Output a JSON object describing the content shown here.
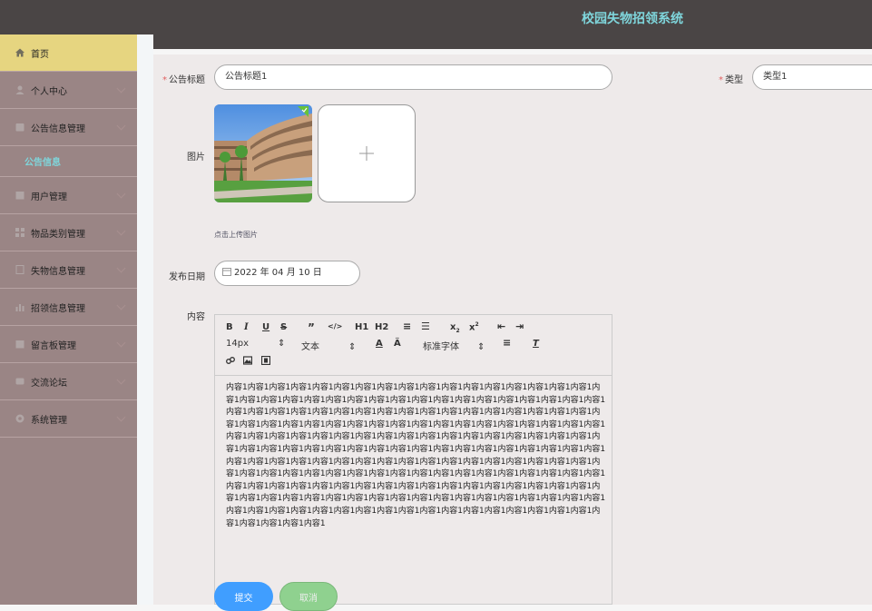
{
  "header": {
    "title": "校园失物招领系统"
  },
  "sidebar": {
    "items": [
      {
        "label": "首页",
        "icon": "home-icon",
        "active": true
      },
      {
        "label": "个人中心",
        "icon": "user-icon"
      },
      {
        "label": "公告信息管理",
        "icon": "notice-icon"
      },
      {
        "label": "用户管理",
        "icon": "users-icon"
      },
      {
        "label": "物品类别管理",
        "icon": "category-icon"
      },
      {
        "label": "失物信息管理",
        "icon": "lost-item-icon"
      },
      {
        "label": "招领信息管理",
        "icon": "chart-icon"
      },
      {
        "label": "留言板管理",
        "icon": "message-icon"
      },
      {
        "label": "交流论坛",
        "icon": "forum-icon"
      },
      {
        "label": "系统管理",
        "icon": "settings-icon"
      }
    ],
    "subitem": "公告信息"
  },
  "form": {
    "title_label": "公告标题",
    "title_value": "公告标题1",
    "type_label": "类型",
    "type_value": "类型1",
    "image_label": "图片",
    "upload_hint": "点击上传图片",
    "date_label": "发布日期",
    "date_value": "2022 年 04 月 10 日",
    "content_label": "内容",
    "content_value": "内容1内容1内容1内容1内容1内容1内容1内容1内容1内容1内容1内容1内容1内容1内容1内容1内容1内容1内容1内容1内容1内容1内容1内容1内容1内容1内容1内容1内容1内容1内容1内容1内容1内容1内容1内容1内容1内容1内容1内容1内容1内容1内容1内容1内容1内容1内容1内容1内容1内容1内容1内容1内容1内容1内容1内容1内容1内容1内容1内容1内容1内容1内容1内容1内容1内容1内容1内容1内容1内容1内容1内容1内容1内容1内容1内容1内容1内容1内容1内容1内容1内容1内容1内容1内容1内容1内容1内容1内容1内容1内容1内容1内容1内容1内容1内容1内容1内容1内容1内容1内容1内容1内容1内容1内容1内容1内容1内容1内容1内容1内容1内容1内容1内容1内容1内容1内容1内容1内容1内容1内容1内容1内容1内容1内容1内容1内容1内容1内容1内容1内容1内容1内容1内容1内容1内容1内容1内容1内容1内容1内容1内容1内容1内容1内容1内容1内容1内容1内容1内容1内容1内容1内容1内容1内容1内容1内容1内容1内容1内容1内容1内容1内容1内容1内容1内容1内容1内容1内容1内容1内容1内容1内容1内容1内容1内容1内容1内容1内容1内容1内容1内容1内容1内容1内容1内容1内容1内容1内容1内容1内容1内容1内容1内容1内容1内容1内容1",
    "submit_label": "提交",
    "cancel_label": "取消"
  },
  "editor": {
    "font_size": "14px",
    "text_type": "文本",
    "font_family": "标准字体",
    "h1": "H1",
    "h2": "H2"
  },
  "colors": {
    "accent": "#7fd6dc",
    "submit": "#409eff",
    "cancel": "#8fd18f",
    "active_menu": "#e6d580"
  }
}
